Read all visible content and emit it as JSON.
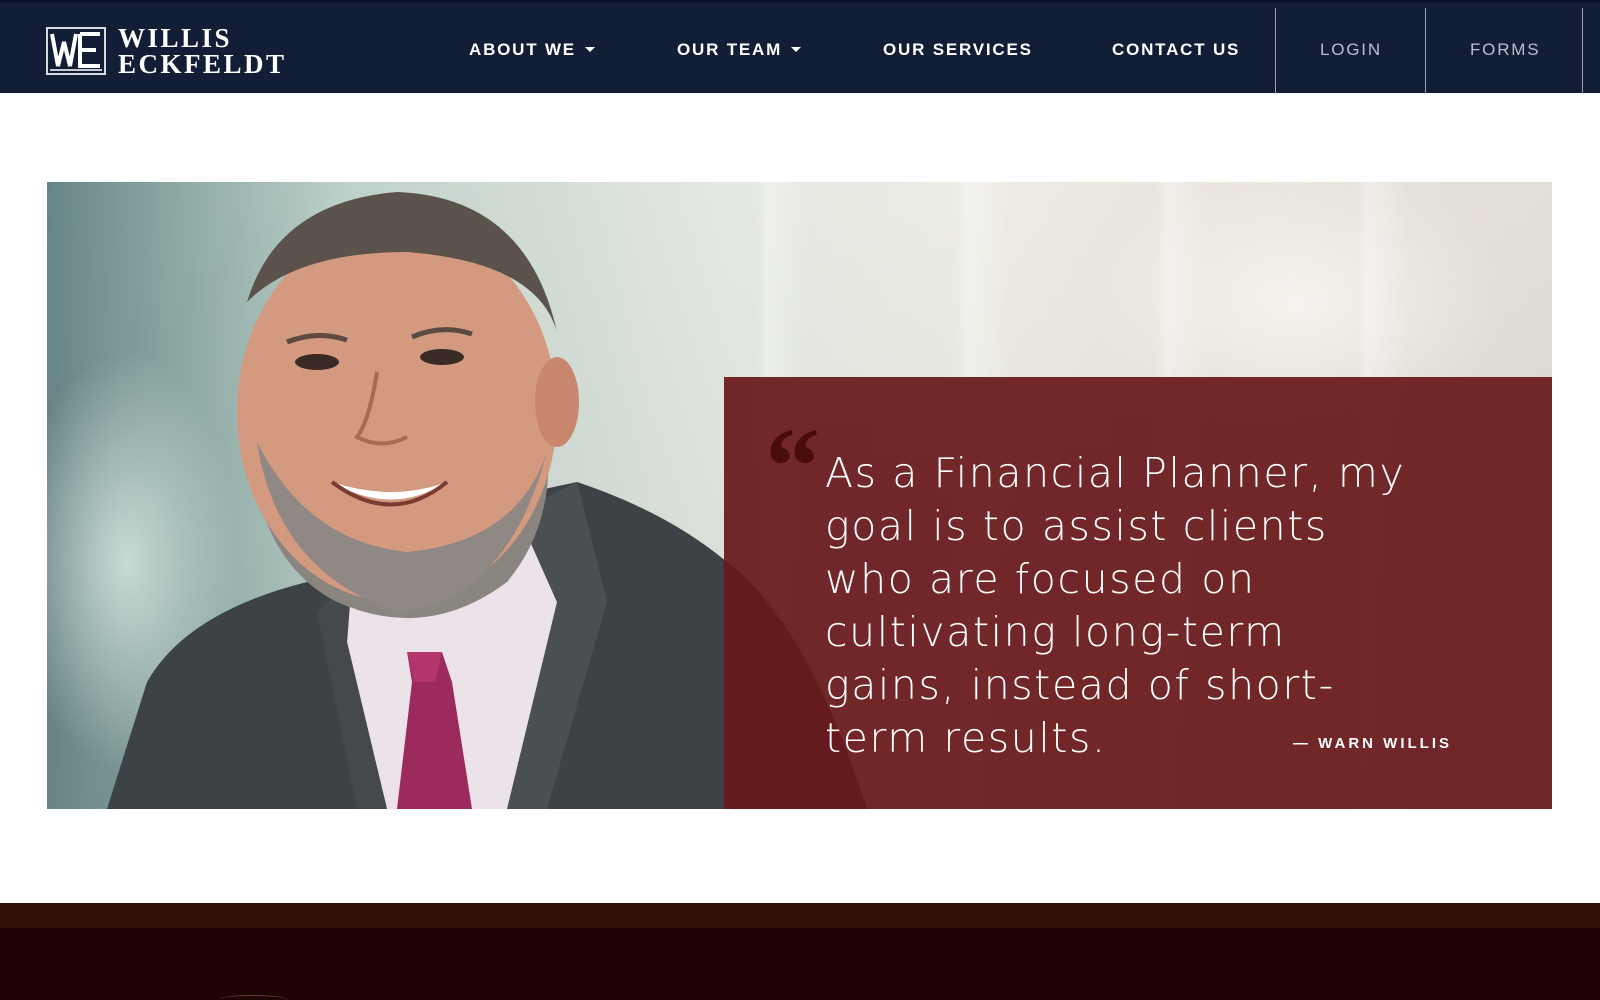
{
  "brand": {
    "name_line1": "WILLIS",
    "name_line2": "ECKFELDT"
  },
  "nav": {
    "items": [
      {
        "label": "ABOUT WE",
        "dropdown": true
      },
      {
        "label": "OUR TEAM",
        "dropdown": true
      },
      {
        "label": "OUR SERVICES",
        "dropdown": false
      },
      {
        "label": "CONTACT US",
        "dropdown": false
      },
      {
        "label": "LOGIN",
        "dropdown": false
      },
      {
        "label": "FORMS",
        "dropdown": false
      }
    ]
  },
  "hero": {
    "quote_mark": "“",
    "quote": "As a Financial Planner, my goal is to assist clients who are focused on cultivating long-term gains, instead of short-term results.",
    "author": "— WARN WILLIS"
  },
  "colors": {
    "nav_bg": "#121d36",
    "quote_bg": "#68191b",
    "footer_bg": "#1f0404"
  }
}
